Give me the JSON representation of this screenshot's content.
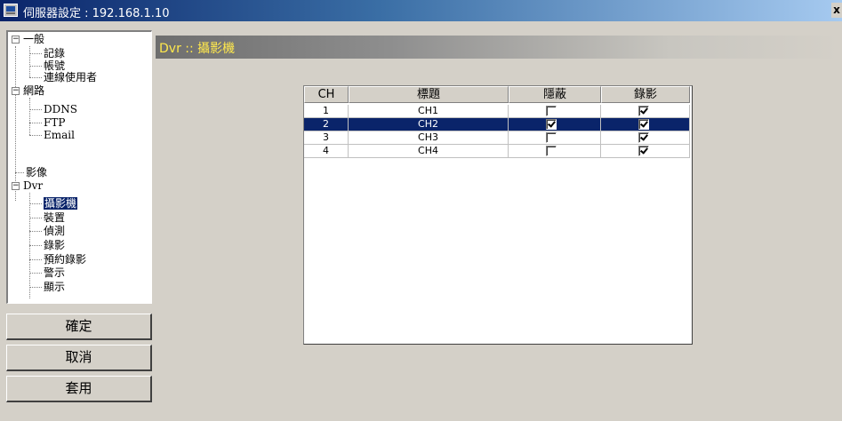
{
  "window": {
    "title": "伺服器設定 : 192.168.1.10",
    "close_label": "x"
  },
  "tree": {
    "general": {
      "label": "一般",
      "children": [
        "記錄",
        "帳號",
        "連線使用者"
      ]
    },
    "network": {
      "label": "網路",
      "children": [
        "DDNS",
        "FTP",
        "Email"
      ]
    },
    "image": {
      "label": "影像"
    },
    "dvr": {
      "label": "Dvr",
      "children": [
        "攝影機",
        "裝置",
        "偵測",
        "錄影",
        "預約錄影",
        "警示",
        "顯示"
      ],
      "selected": "攝影機"
    }
  },
  "buttons": {
    "ok": "確定",
    "cancel": "取消",
    "apply": "套用"
  },
  "section": {
    "title": "Dvr :: 攝影機"
  },
  "camera_table": {
    "headers": [
      "CH",
      "標題",
      "隱蔽",
      "錄影"
    ],
    "rows": [
      {
        "ch": "1",
        "title": "CH1",
        "covert": false,
        "record": true
      },
      {
        "ch": "2",
        "title": "CH2",
        "covert": true,
        "record": true,
        "selected": true
      },
      {
        "ch": "3",
        "title": "CH3",
        "covert": false,
        "record": true
      },
      {
        "ch": "4",
        "title": "CH4",
        "covert": false,
        "record": true
      }
    ]
  },
  "colors": {
    "selection": "#0a246a",
    "header_text": "#ffe84d"
  }
}
